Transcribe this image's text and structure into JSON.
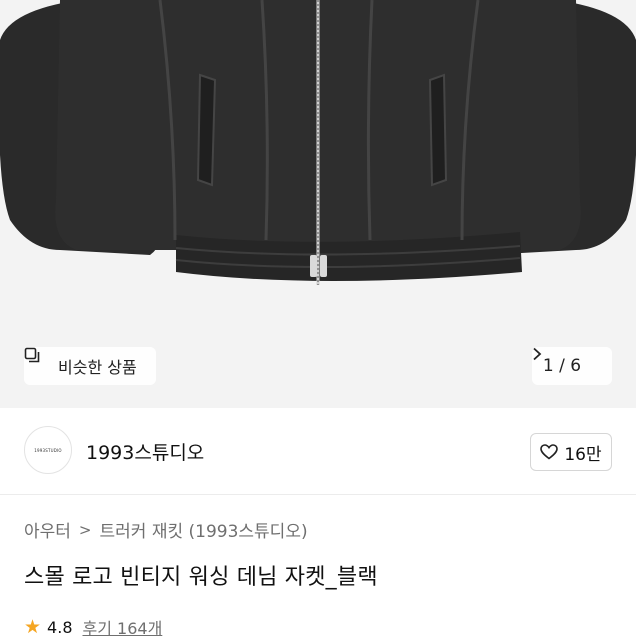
{
  "product_image": {
    "similar_label": "비슷한 상품",
    "pager": "1 / 6"
  },
  "shop": {
    "logo_text": "1993STUDIO",
    "name": "1993스튜디오",
    "likes": "16만"
  },
  "breadcrumb": {
    "category": "아우터",
    "separator": ">",
    "subcategory": "트러커 재킷 (1993스튜디오)"
  },
  "product": {
    "title": "스몰 로고 빈티지 워싱 데님 자켓_블랙",
    "rating": "4.8",
    "reviews": "후기 164개"
  },
  "colors": {
    "background": "#f3f3f3",
    "star": "#f5a623",
    "jacket": "#2b2b2b"
  },
  "icons": [
    "similar-items-icon",
    "chevron-right-icon",
    "heart-icon",
    "star-icon"
  ]
}
